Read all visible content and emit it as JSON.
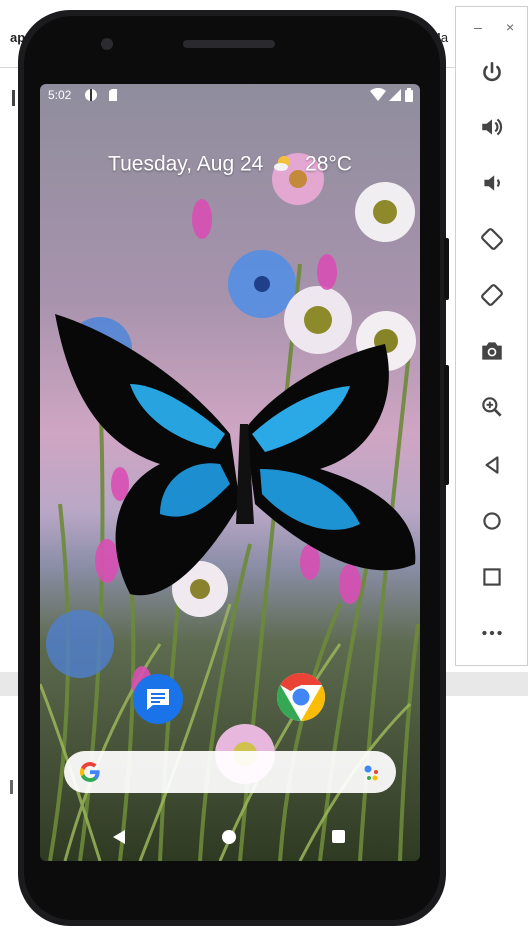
{
  "host_window": {
    "title_left": "ap",
    "title_right": "Ma"
  },
  "toolbar": {
    "min_label": "–",
    "close_label": "×",
    "buttons": [
      {
        "name": "power-icon",
        "label": "power"
      },
      {
        "name": "volume-up-icon",
        "label": "volume up"
      },
      {
        "name": "volume-down-icon",
        "label": "volume down"
      },
      {
        "name": "rotate-left-icon",
        "label": "rotate left"
      },
      {
        "name": "rotate-right-icon",
        "label": "rotate right"
      },
      {
        "name": "camera-icon",
        "label": "screenshot"
      },
      {
        "name": "zoom-icon",
        "label": "zoom"
      },
      {
        "name": "back-icon",
        "label": "back"
      },
      {
        "name": "home-icon",
        "label": "home"
      },
      {
        "name": "overview-icon",
        "label": "overview"
      },
      {
        "name": "more-icon",
        "label": "more"
      }
    ]
  },
  "status_bar": {
    "time": "5:02"
  },
  "home": {
    "date": "Tuesday, Aug 24",
    "temperature": "28°C"
  },
  "apps": [
    {
      "name": "messages-app-icon"
    },
    {
      "name": "chrome-app-icon"
    }
  ],
  "colors": {
    "messages_blue": "#1a73e8",
    "toolbar_icon": "#444444"
  }
}
